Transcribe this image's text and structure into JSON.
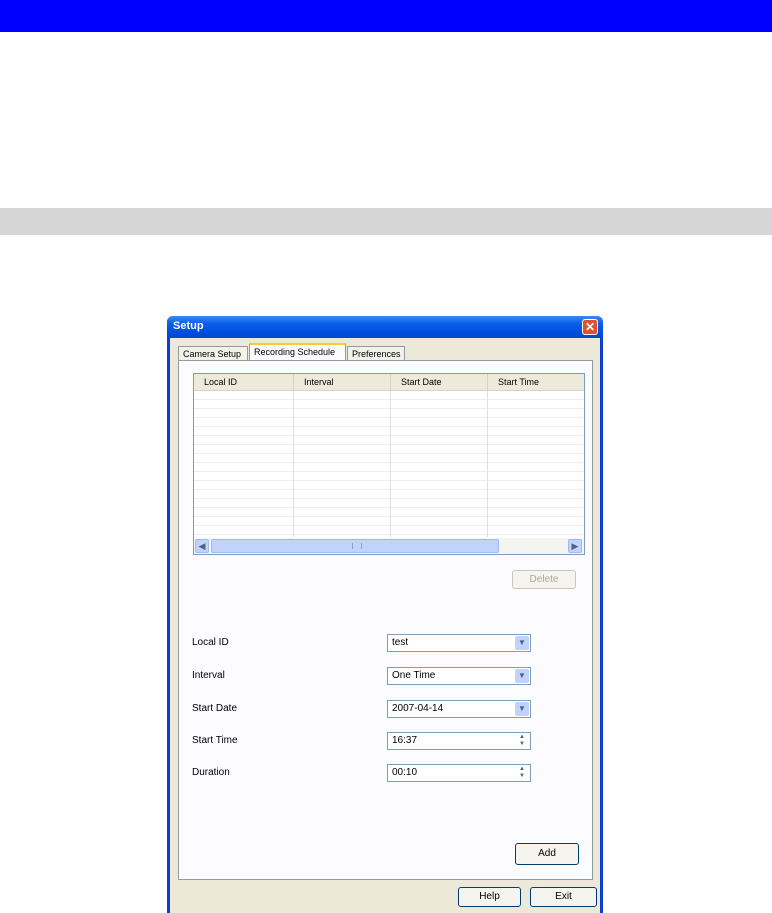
{
  "window": {
    "title": "Setup",
    "close_glyph": "✕"
  },
  "tabs": [
    {
      "label": "Camera Setup"
    },
    {
      "label": "Recording Schedule"
    },
    {
      "label": "Preferences"
    }
  ],
  "active_tab": "Recording Schedule",
  "grid": {
    "columns": [
      "Local ID",
      "Interval",
      "Start Date",
      "Start Time"
    ],
    "rows": []
  },
  "delete_button": "Delete",
  "fields": {
    "local_id": {
      "label": "Local ID",
      "value": "test"
    },
    "interval": {
      "label": "Interval",
      "value": "One Time"
    },
    "start_date": {
      "label": "Start Date",
      "value": "2007-04-14"
    },
    "start_time": {
      "label": "Start Time",
      "value": "16:37"
    },
    "duration": {
      "label": "Duration",
      "value": "00:10"
    }
  },
  "add_button": "Add",
  "help_button": "Help",
  "exit_button": "Exit",
  "icons": {
    "dropdown": "chevron-down-icon",
    "spinner": "spinner-icon",
    "scroll_left": "chevron-left-icon",
    "scroll_right": "chevron-right-icon",
    "close": "close-icon"
  },
  "colors": {
    "header_bar": "#0000ff",
    "section_bar": "#d6d6d6",
    "titlebar": "#0054e3",
    "dialog_bg": "#ece9d8"
  }
}
